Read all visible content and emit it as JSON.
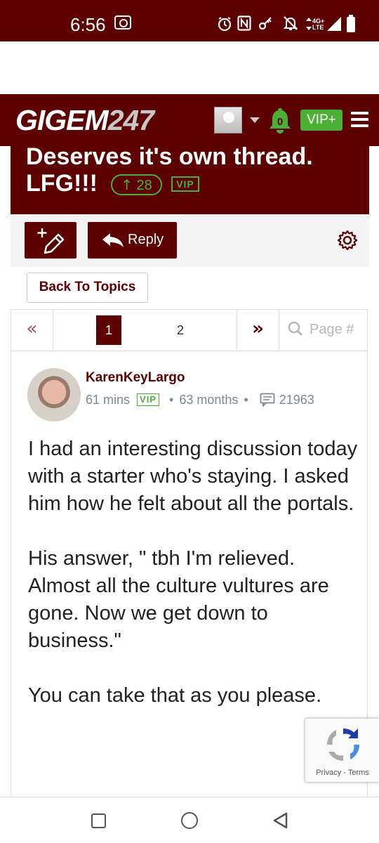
{
  "status_bar": {
    "time": "6:56",
    "icons": [
      "screen-record-icon",
      "alarm-icon",
      "nfc-icon",
      "key-icon",
      "mute-icon",
      "data-arrows-icon",
      "signal-icon",
      "battery-icon"
    ],
    "network_top": "4G+",
    "network_bottom": "LTE"
  },
  "header": {
    "logo_text": "GIGEM",
    "logo_number": "247",
    "notification_count": "0",
    "vip_label": "VIP+"
  },
  "thread": {
    "title_line1": "Deserves it's own thread.",
    "title_line2": "LFG!!!",
    "upvote_arrow": "↑",
    "upvotes": "28",
    "vip_tag": "VIP"
  },
  "toolbar": {
    "reply_label": "Reply",
    "back_label": "Back To Topics"
  },
  "pagination": {
    "first": "«",
    "pages": [
      "1",
      "2"
    ],
    "current": "1",
    "last": "»",
    "search_placeholder": "Page #"
  },
  "post": {
    "author": "KarenKeyLargo",
    "time_ago": "61 mins",
    "vip_tag": "VIP",
    "tenure": "63 months",
    "post_count": "21963",
    "paragraphs": [
      "I had an interesting discussion today with a starter who's staying. I asked him how he felt about all the portals.",
      "His answer, \" tbh I'm relieved. Almost all the culture vultures are gone. Now we get down to business.\"",
      "You can take that as you please."
    ]
  },
  "recaptcha": {
    "privacy": "Privacy",
    "separator": "-",
    "terms": "Terms"
  },
  "colors": {
    "brand_maroon": "#5c0000",
    "vip_green": "#4caf35"
  }
}
